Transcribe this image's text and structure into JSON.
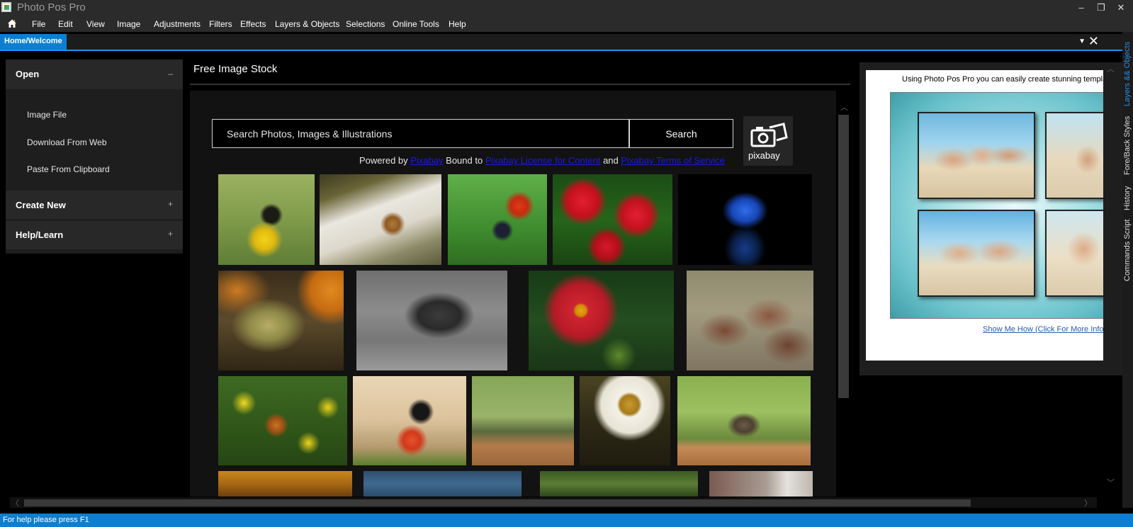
{
  "app": {
    "title": "Photo Pos Pro"
  },
  "window_controls": {
    "minimize": "–",
    "restore": "❐",
    "close": "✕"
  },
  "menu": [
    "File",
    "Edit",
    "View",
    "Image",
    "Adjustments",
    "Filters",
    "Effects",
    "Layers & Objects",
    "Selections",
    "Online Tools",
    "Help"
  ],
  "tabs": {
    "active": "Home/Welcome",
    "dropdown": "▼",
    "close": "✕"
  },
  "side_tabs": [
    "Layers && Objects",
    "Fore/Back Styles",
    "History",
    "Commands Script"
  ],
  "left_panel": {
    "open": {
      "title": "Open",
      "sign": "–",
      "items": [
        "Image File",
        "Download From Web",
        "Paste From Clipboard"
      ]
    },
    "create_new": {
      "title": "Create New",
      "sign": "+"
    },
    "help_learn": {
      "title": "Help/Learn",
      "sign": "+"
    }
  },
  "main": {
    "section_title": "Free Image Stock",
    "search": {
      "placeholder": "Search Photos, Images & Illustrations",
      "button": "Search"
    },
    "pixabay_logo_text": "pixabay",
    "powered": {
      "prefix": "Powered by",
      "link1": "Pixabay",
      "mid": "Bound to",
      "link2": "Pixabay License for Content",
      "and": "and",
      "link3": "Pixabay Terms of Service"
    },
    "thumbnails": [
      "butterfly-on-yellow-flowers",
      "squirrel-on-branch",
      "butterfly-on-red-flower",
      "red-flowers",
      "blue-rose",
      "pumpkins-and-gourds",
      "cowboy-boot-bw",
      "red-dahlia",
      "chickens",
      "butterfly-on-yellow-flowers-2",
      "butterfly-on-zinnia",
      "cat-on-fence",
      "white-coneflower",
      "cat-sitting-on-fence",
      "autumn-trees",
      "water",
      "moss",
      "dog"
    ]
  },
  "promo": {
    "text": "Using Photo Pos Pro you can easily create stunning templa",
    "link": "Show Me How (Click For More Info)"
  },
  "scroll": {
    "up": "︿",
    "down": "﹀",
    "left": "〈",
    "right": "〉"
  },
  "status": "For help please press F1"
}
